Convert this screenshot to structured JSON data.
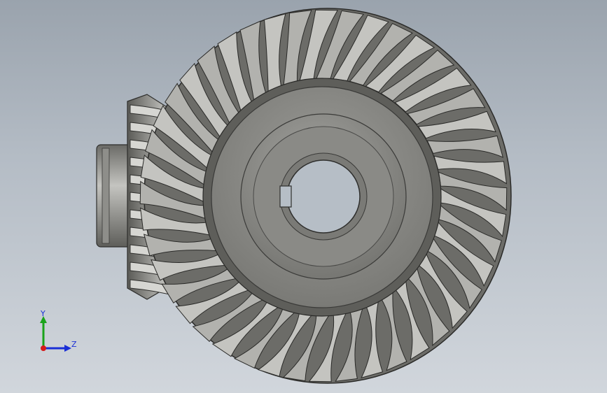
{
  "viewport": {
    "background_top": "#9aa3ad",
    "background_bottom": "#d1d6dc"
  },
  "model": {
    "gear_color": "#8a8a86",
    "gear_dark": "#3c3c3a",
    "gear_light": "#d4d4d0",
    "pinion_color": "#8e8e8a"
  },
  "triad": {
    "y_label": "Y",
    "z_label": "Z",
    "y_axis_color": "#1aa31a",
    "z_axis_color": "#1a2fd6",
    "x_axis_color": "#d61a1a",
    "label_color": "#1a2fd6"
  }
}
